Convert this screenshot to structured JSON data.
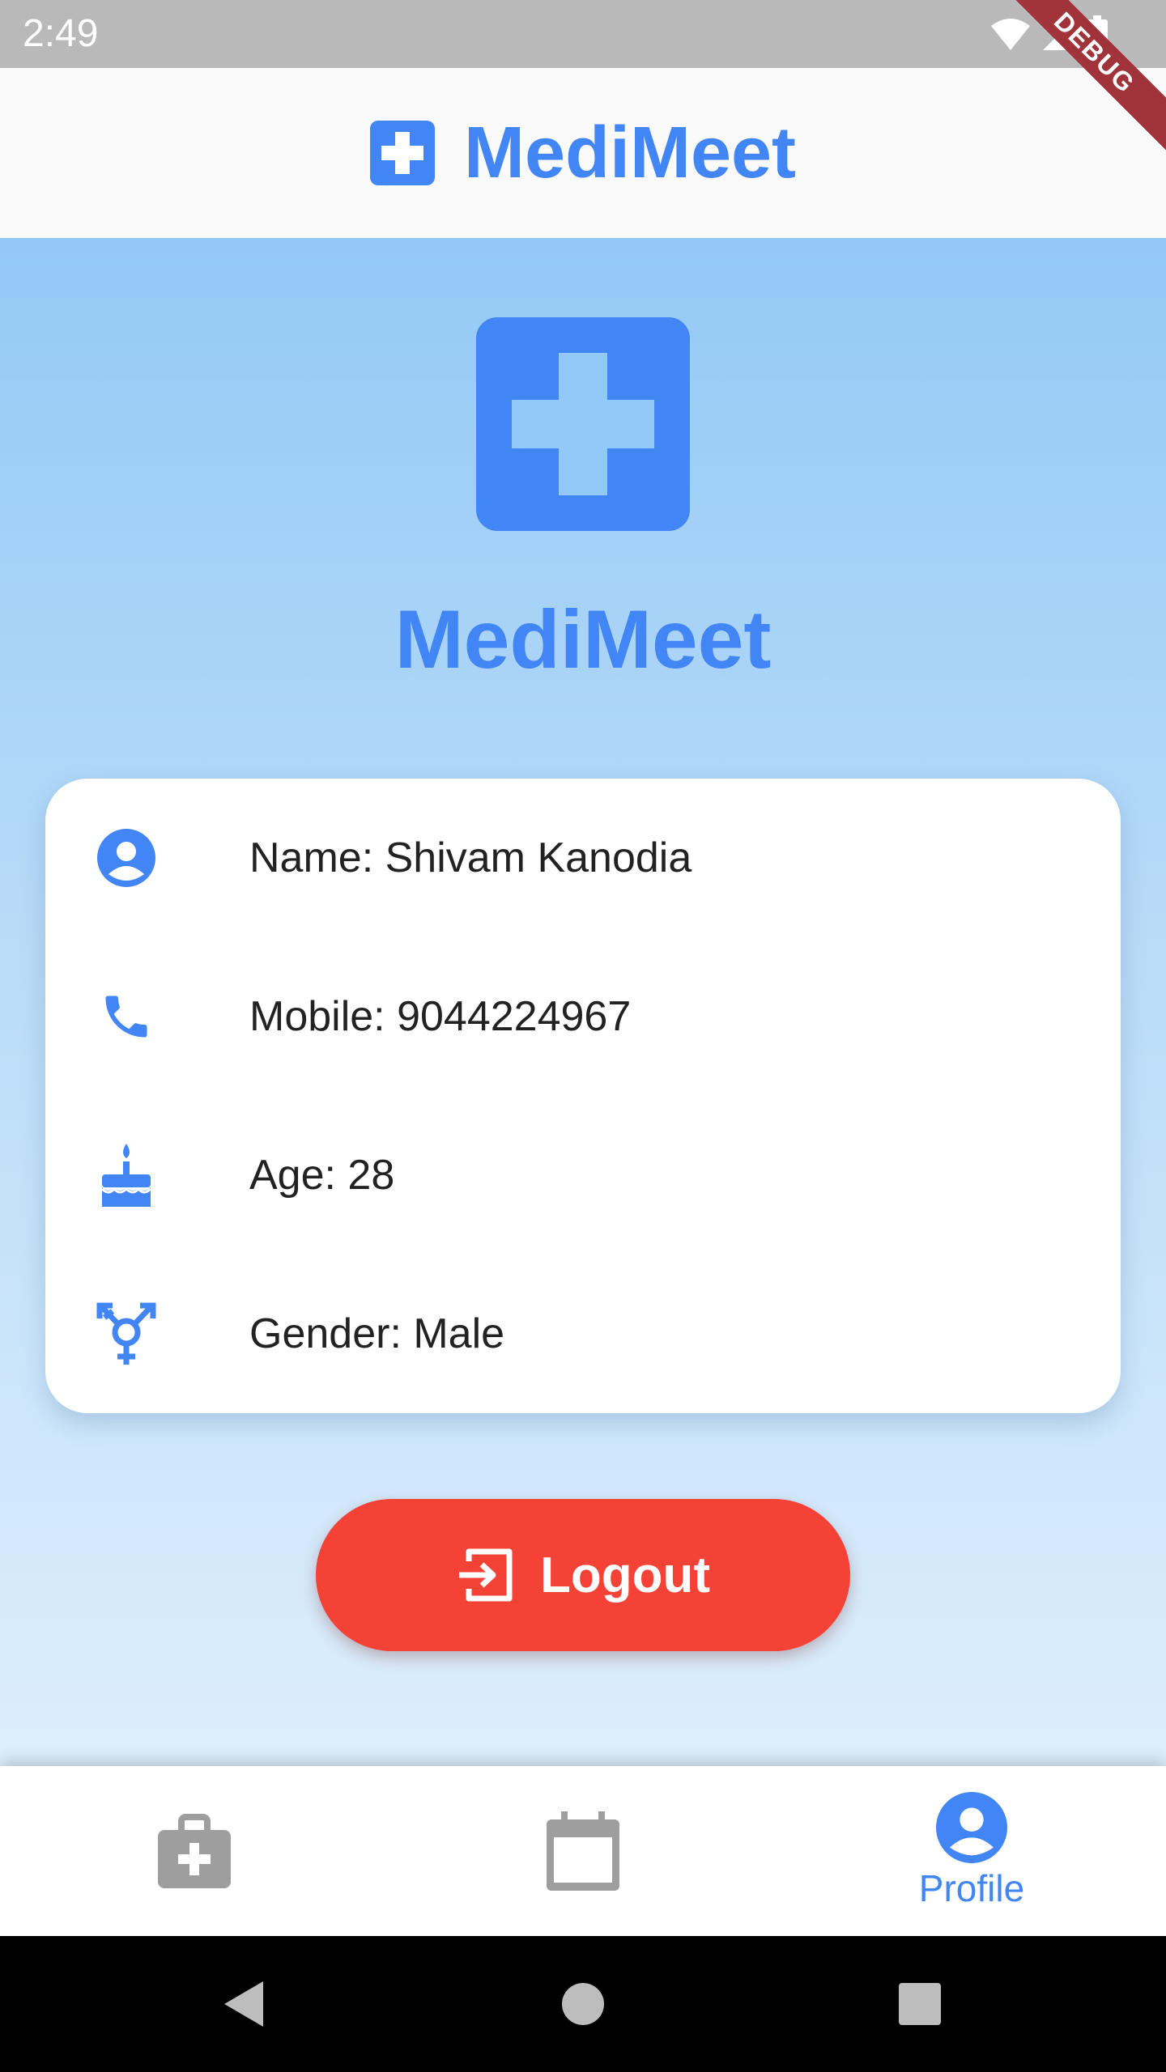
{
  "status_bar": {
    "time": "2:49",
    "debug_label": "DEBUG"
  },
  "app_bar": {
    "title": "MediMeet",
    "icon": "medical-cross-icon"
  },
  "hero": {
    "title": "MediMeet",
    "icon": "medical-cross-icon"
  },
  "profile": {
    "rows": [
      {
        "icon": "account-circle-icon",
        "text": "Name: Shivam Kanodia"
      },
      {
        "icon": "phone-icon",
        "text": "Mobile: 9044224967"
      },
      {
        "icon": "cake-icon",
        "text": "Age: 28"
      },
      {
        "icon": "transgender-icon",
        "text": "Gender: Male"
      }
    ]
  },
  "logout_button": {
    "label": "Logout",
    "icon": "logout-icon"
  },
  "bottom_nav": {
    "items": [
      {
        "icon": "medical-bag-icon",
        "label": "",
        "active": false
      },
      {
        "icon": "calendar-icon",
        "label": "",
        "active": false
      },
      {
        "icon": "account-circle-icon",
        "label": "Profile",
        "active": true
      }
    ]
  },
  "colors": {
    "primary": "#4285f4",
    "danger": "#f44336",
    "inactive": "#9e9e9e",
    "gradient_top": "#93c9f6",
    "gradient_bottom": "#ddeefc"
  }
}
